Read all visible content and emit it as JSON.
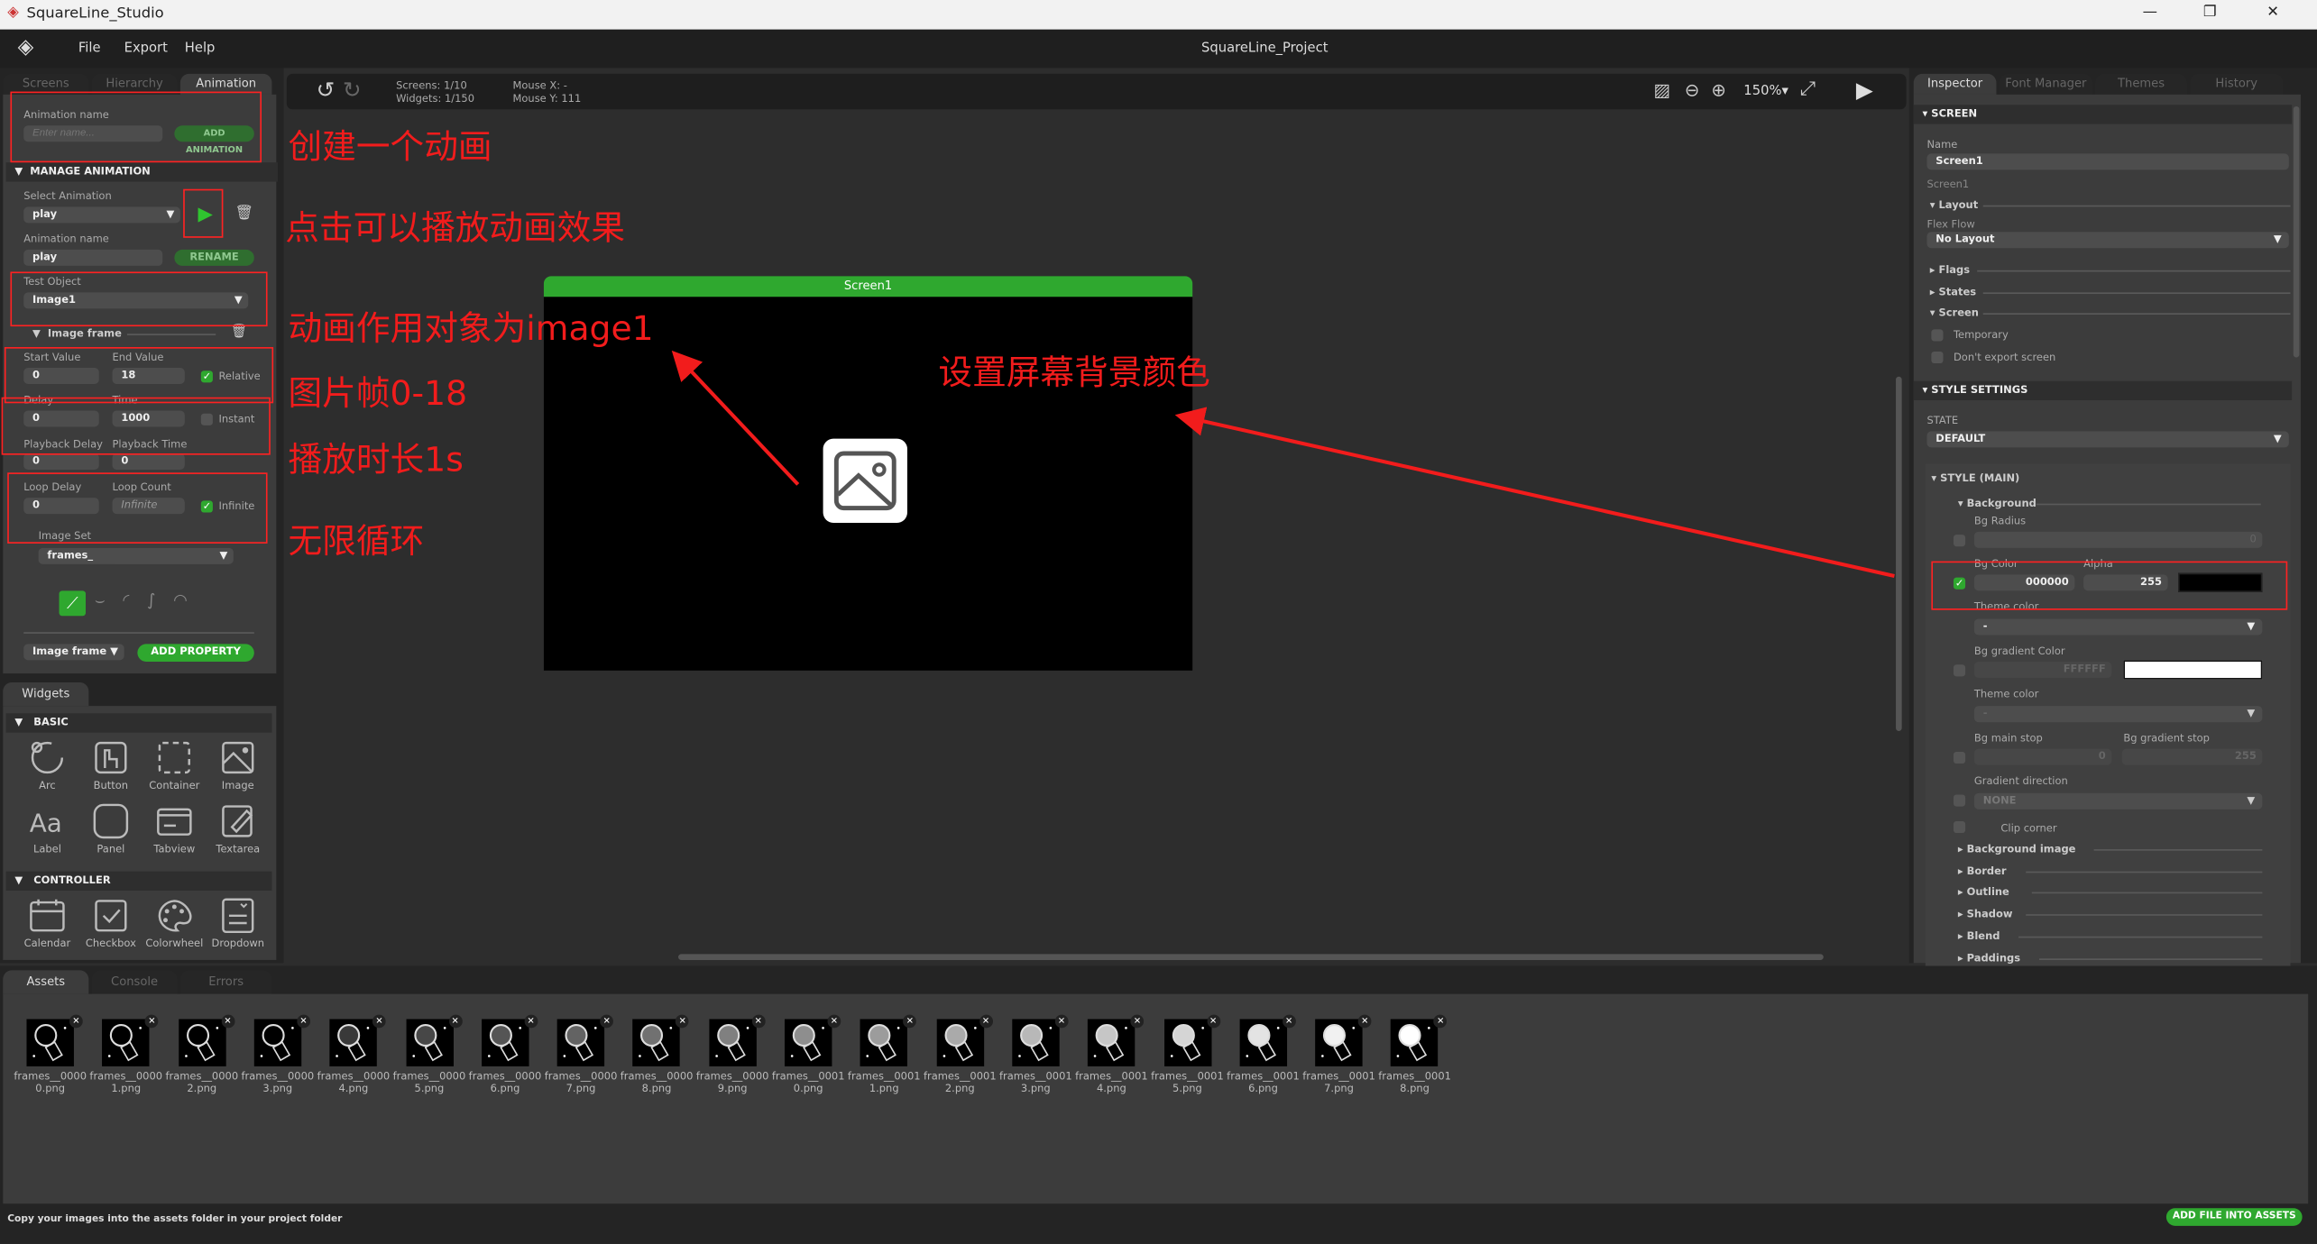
{
  "window": {
    "title": "SquareLine_Studio",
    "project": "SquareLine_Project",
    "controls": [
      "—",
      "❐",
      "✕"
    ]
  },
  "menu": [
    "File",
    "Export",
    "Help"
  ],
  "left_tabs": [
    "Screens",
    "Hierarchy",
    "Animation"
  ],
  "animation": {
    "name_label": "Animation name",
    "name_placeholder": "Enter name...",
    "add_button": "ADD ANIMATION",
    "manage_title": "MANAGE ANIMATION",
    "select_label": "Select Animation",
    "select_value": "play",
    "anim_name_label": "Animation name",
    "anim_name_value": "play",
    "rename_button": "RENAME",
    "test_object_label": "Test Object",
    "test_object_value": "Image1",
    "property_title": "Image frame",
    "start_label": "Start Value",
    "start_value": "0",
    "end_label": "End Value",
    "end_value": "18",
    "relative_label": "Relative",
    "relative_checked": true,
    "delay_label": "Delay",
    "delay_value": "0",
    "time_label": "Time",
    "time_value": "1000",
    "instant_label": "Instant",
    "instant_checked": false,
    "pb_delay_label": "Playback Delay",
    "pb_delay_value": "0",
    "pb_time_label": "Playback Time",
    "pb_time_value": "0",
    "loop_delay_label": "Loop Delay",
    "loop_delay_value": "0",
    "loop_count_label": "Loop Count",
    "loop_count_value": "Infinite",
    "infinite_label": "Infinite",
    "infinite_checked": true,
    "image_set_label": "Image Set",
    "image_set_value": "frames_",
    "property_select": "Image frame",
    "add_property_button": "ADD PROPERTY"
  },
  "widgets": {
    "tab": "Widgets",
    "basic_title": "BASIC",
    "basic": [
      "Arc",
      "Button",
      "Container",
      "Image",
      "Label",
      "Panel",
      "Tabview",
      "Textarea"
    ],
    "controller_title": "CONTROLLER",
    "controller": [
      "Calendar",
      "Checkbox",
      "Colorwheel",
      "Dropdown"
    ]
  },
  "toolbar": {
    "screens": "Screens: 1/10",
    "widgets": "Widgets: 1/150",
    "mouse_x": "Mouse X: -",
    "mouse_y": "Mouse Y: 111",
    "zoom": "150%"
  },
  "canvas": {
    "screen_title": "Screen1",
    "bg_color": "#000000",
    "header_color": "#2fa82f"
  },
  "right_tabs": [
    "Inspector",
    "Font Manager",
    "Themes",
    "History"
  ],
  "inspector": {
    "screen_title": "SCREEN",
    "name_label": "Name",
    "name_value": "Screen1",
    "name_hint": "Screen1",
    "layout": "Layout",
    "flex_flow_label": "Flex Flow",
    "flex_flow_value": "No Layout",
    "flags": "Flags",
    "states": "States",
    "screen": "Screen",
    "temporary": "Temporary",
    "dont_export": "Don't export screen",
    "style_title": "STYLE SETTINGS",
    "state_label": "STATE",
    "state_value": "DEFAULT",
    "style_main": "STYLE (MAIN)",
    "background": "Background",
    "bg_radius_label": "Bg Radius",
    "bg_radius_value": "0",
    "bg_color_label": "Bg Color",
    "bg_color_value": "000000",
    "alpha_label": "Alpha",
    "alpha_value": "255",
    "theme_color_label": "Theme color",
    "theme_color_value": "-",
    "grad_color_label": "Bg gradient Color",
    "grad_color_value": "FFFFFF",
    "theme_color2_label": "Theme color",
    "theme_color2_value": "-",
    "main_stop_label": "Bg main stop",
    "main_stop_value": "0",
    "grad_stop_label": "Bg gradient stop",
    "grad_stop_value": "255",
    "grad_dir_label": "Gradient direction",
    "grad_dir_value": "NONE",
    "clip_corner": "Clip corner",
    "groups": [
      "Background image",
      "Border",
      "Outline",
      "Shadow",
      "Blend",
      "Paddings"
    ]
  },
  "bottom_tabs": [
    "Assets",
    "Console",
    "Errors"
  ],
  "assets": [
    [
      "frames__0000",
      "0.png"
    ],
    [
      "frames__0000",
      "1.png"
    ],
    [
      "frames__0000",
      "2.png"
    ],
    [
      "frames__0000",
      "3.png"
    ],
    [
      "frames__0000",
      "4.png"
    ],
    [
      "frames__0000",
      "5.png"
    ],
    [
      "frames__0000",
      "6.png"
    ],
    [
      "frames__0000",
      "7.png"
    ],
    [
      "frames__0000",
      "8.png"
    ],
    [
      "frames__0000",
      "9.png"
    ],
    [
      "frames__0001",
      "0.png"
    ],
    [
      "frames__0001",
      "1.png"
    ],
    [
      "frames__0001",
      "2.png"
    ],
    [
      "frames__0001",
      "3.png"
    ],
    [
      "frames__0001",
      "4.png"
    ],
    [
      "frames__0001",
      "5.png"
    ],
    [
      "frames__0001",
      "6.png"
    ],
    [
      "frames__0001",
      "7.png"
    ],
    [
      "frames__0001",
      "8.png"
    ]
  ],
  "footer": {
    "hint": "Copy your images into the assets folder in your project folder",
    "add_button": "ADD FILE INTO ASSETS"
  },
  "annotations": [
    "创建一个动画",
    "点击可以播放动画效果",
    "动画作用对象为image1",
    "图片帧0-18",
    "播放时长1s",
    "无限循环",
    "设置屏幕背景颜色"
  ],
  "annotation_color": "#f21c1c"
}
